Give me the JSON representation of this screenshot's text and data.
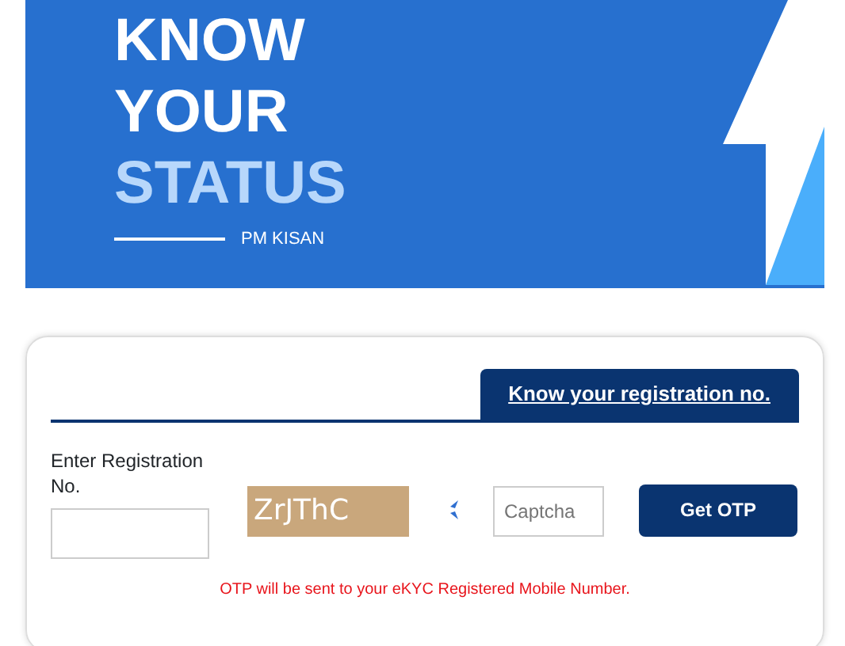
{
  "banner": {
    "title_lines": [
      "KNOW",
      "YOUR"
    ],
    "highlight": "STATUS",
    "subtitle": "PM KISAN"
  },
  "form": {
    "link": "Know your registration no.",
    "registration": {
      "label": "Enter Registration No."
    },
    "captcha": {
      "code": "ZrJThC",
      "placeholder": "Captcha"
    },
    "button": "Get OTP",
    "note": "OTP will be sent to your eKYC Registered Mobile Number."
  }
}
